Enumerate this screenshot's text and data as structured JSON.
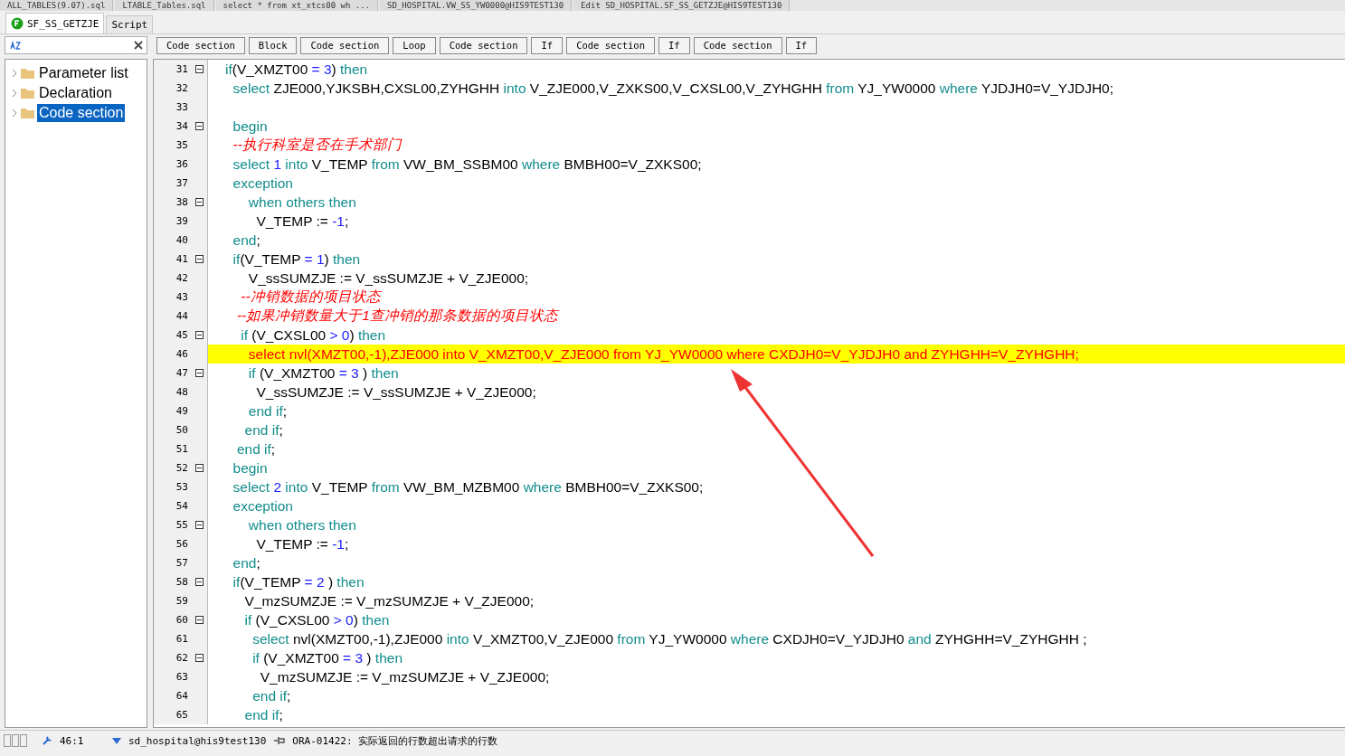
{
  "file_tabs": [
    "ALL_TABLES(9.07).sql",
    "LTABLE_Tables.sql",
    "select * from xt_xtcs00 wh ...",
    "SD_HOSPITAL.VW_SS_YW0000@HIS9TEST130",
    "Edit SD_HOSPITAL.SF_SS_GETZJE@HIS9TEST130"
  ],
  "doc_tabs": [
    {
      "label": "SF_SS_GETZJE",
      "selected": true
    },
    {
      "label": "Script",
      "selected": false
    }
  ],
  "breadcrumb": [
    "Code section",
    "Block",
    "Code section",
    "Loop",
    "Code section",
    "If",
    "Code section",
    "If",
    "Code section",
    "If"
  ],
  "tree": [
    {
      "label": "Parameter list",
      "selected": false
    },
    {
      "label": "Declaration",
      "selected": false
    },
    {
      "label": "Code section",
      "selected": true
    }
  ],
  "editor": {
    "lines": [
      {
        "no": "31",
        "fold": true,
        "selected": false,
        "segs": [
          {
            "kind": "keyword",
            "text": "if"
          },
          {
            "kind": "plain",
            "text": "(V_XMZT00 "
          },
          {
            "kind": "number",
            "text": "= 3"
          },
          {
            "kind": "plain",
            "text": ") "
          },
          {
            "kind": "keyword",
            "text": "then"
          }
        ]
      },
      {
        "no": "32",
        "fold": false,
        "selected": false,
        "segs": [
          {
            "kind": "keyword",
            "text": "  select "
          },
          {
            "kind": "plain",
            "text": "ZJE000,YJKSBH,CXSL00,ZYHGHH "
          },
          {
            "kind": "keyword",
            "text": "into "
          },
          {
            "kind": "plain",
            "text": "V_ZJE000,V_ZXKS00,V_CXSL00,V_ZYHGHH "
          },
          {
            "kind": "keyword",
            "text": "from "
          },
          {
            "kind": "plain",
            "text": "YJ_YW0000 "
          },
          {
            "kind": "keyword",
            "text": "where "
          },
          {
            "kind": "plain",
            "text": "YJDJH0=V_YJDJH0;"
          }
        ]
      },
      {
        "no": "33",
        "fold": false,
        "selected": false
      },
      {
        "no": "34",
        "fold": true,
        "selected": false,
        "segs": [
          {
            "kind": "keyword",
            "text": "  begin"
          }
        ]
      },
      {
        "no": "35",
        "fold": false,
        "selected": false,
        "segs": [
          {
            "kind": "comment",
            "text": "  --执行科室是否在手术部门"
          }
        ]
      },
      {
        "no": "36",
        "fold": false,
        "selected": false,
        "segs": [
          {
            "kind": "keyword",
            "text": "  select "
          },
          {
            "kind": "number",
            "text": "1 "
          },
          {
            "kind": "keyword",
            "text": "into "
          },
          {
            "kind": "plain",
            "text": "V_TEMP "
          },
          {
            "kind": "keyword",
            "text": "from "
          },
          {
            "kind": "plain",
            "text": "VW_BM_SSBM00 "
          },
          {
            "kind": "keyword",
            "text": "where "
          },
          {
            "kind": "plain",
            "text": "BMBH00=V_ZXKS00;"
          }
        ]
      },
      {
        "no": "37",
        "fold": false,
        "selected": false,
        "segs": [
          {
            "kind": "keyword",
            "text": "  exception"
          }
        ]
      },
      {
        "no": "38",
        "fold": true,
        "selected": false,
        "segs": [
          {
            "kind": "keyword",
            "text": "      when others then"
          }
        ]
      },
      {
        "no": "39",
        "fold": false,
        "selected": false,
        "segs": [
          {
            "kind": "plain",
            "text": "        V_TEMP := "
          },
          {
            "kind": "number",
            "text": "-1"
          },
          {
            "kind": "plain",
            "text": ";"
          }
        ]
      },
      {
        "no": "40",
        "fold": false,
        "selected": false,
        "segs": [
          {
            "kind": "keyword",
            "text": "  end"
          },
          {
            "kind": "plain",
            "text": ";"
          }
        ]
      },
      {
        "no": "41",
        "fold": true,
        "selected": false,
        "segs": [
          {
            "kind": "keyword",
            "text": "  if"
          },
          {
            "kind": "plain",
            "text": "(V_TEMP "
          },
          {
            "kind": "number",
            "text": "= 1"
          },
          {
            "kind": "plain",
            "text": ") "
          },
          {
            "kind": "keyword",
            "text": "then"
          }
        ]
      },
      {
        "no": "42",
        "fold": false,
        "selected": false,
        "segs": [
          {
            "kind": "plain",
            "text": "      V_ssSUMZJE := V_ssSUMZJE + V_ZJE000;"
          }
        ]
      },
      {
        "no": "43",
        "fold": false,
        "selected": false,
        "segs": [
          {
            "kind": "comment",
            "text": "    --冲销数据的项目状态"
          }
        ]
      },
      {
        "no": "44",
        "fold": false,
        "selected": false,
        "segs": [
          {
            "kind": "comment",
            "text": "   --如果冲销数量大于1查冲销的那条数据的项目状态"
          }
        ]
      },
      {
        "no": "45",
        "fold": true,
        "selected": false,
        "segs": [
          {
            "kind": "keyword",
            "text": "    if "
          },
          {
            "kind": "plain",
            "text": "(V_CXSL00 "
          },
          {
            "kind": "number",
            "text": "> 0"
          },
          {
            "kind": "plain",
            "text": ") "
          },
          {
            "kind": "keyword",
            "text": "then"
          }
        ]
      },
      {
        "no": "46",
        "fold": false,
        "selected": true,
        "segs": [
          {
            "kind": "plain",
            "text": "      select nvl(XMZT00,-1),ZJE000 into V_XMZT00,V_ZJE000 from YJ_YW0000 where CXDJH0=V_YJDJH0 and ZYHGHH=V_ZYHGHH;"
          }
        ]
      },
      {
        "no": "47",
        "fold": true,
        "selected": false,
        "segs": [
          {
            "kind": "keyword",
            "text": "      if "
          },
          {
            "kind": "plain",
            "text": "(V_XMZT00 "
          },
          {
            "kind": "number",
            "text": "= 3 "
          },
          {
            "kind": "plain",
            "text": ") "
          },
          {
            "kind": "keyword",
            "text": "then"
          }
        ]
      },
      {
        "no": "48",
        "fold": false,
        "selected": false,
        "segs": [
          {
            "kind": "plain",
            "text": "        V_ssSUMZJE := V_ssSUMZJE + V_ZJE000;"
          }
        ]
      },
      {
        "no": "49",
        "fold": false,
        "selected": false,
        "segs": [
          {
            "kind": "keyword",
            "text": "      end if"
          },
          {
            "kind": "plain",
            "text": ";"
          }
        ]
      },
      {
        "no": "50",
        "fold": false,
        "selected": false,
        "segs": [
          {
            "kind": "keyword",
            "text": "     end if"
          },
          {
            "kind": "plain",
            "text": ";"
          }
        ]
      },
      {
        "no": "51",
        "fold": false,
        "selected": false,
        "segs": [
          {
            "kind": "keyword",
            "text": "   end if"
          },
          {
            "kind": "plain",
            "text": ";"
          }
        ]
      },
      {
        "no": "52",
        "fold": true,
        "selected": false,
        "segs": [
          {
            "kind": "keyword",
            "text": "  begin"
          }
        ]
      },
      {
        "no": "53",
        "fold": false,
        "selected": false,
        "segs": [
          {
            "kind": "keyword",
            "text": "  select "
          },
          {
            "kind": "number",
            "text": "2 "
          },
          {
            "kind": "keyword",
            "text": "into "
          },
          {
            "kind": "plain",
            "text": "V_TEMP "
          },
          {
            "kind": "keyword",
            "text": "from "
          },
          {
            "kind": "plain",
            "text": "VW_BM_MZBM00 "
          },
          {
            "kind": "keyword",
            "text": "where "
          },
          {
            "kind": "plain",
            "text": "BMBH00=V_ZXKS00;"
          }
        ]
      },
      {
        "no": "54",
        "fold": false,
        "selected": false,
        "segs": [
          {
            "kind": "keyword",
            "text": "  exception"
          }
        ]
      },
      {
        "no": "55",
        "fold": true,
        "selected": false,
        "segs": [
          {
            "kind": "keyword",
            "text": "      when others then"
          }
        ]
      },
      {
        "no": "56",
        "fold": false,
        "selected": false,
        "segs": [
          {
            "kind": "plain",
            "text": "        V_TEMP := "
          },
          {
            "kind": "number",
            "text": "-1"
          },
          {
            "kind": "plain",
            "text": ";"
          }
        ]
      },
      {
        "no": "57",
        "fold": false,
        "selected": false,
        "segs": [
          {
            "kind": "keyword",
            "text": "  end"
          },
          {
            "kind": "plain",
            "text": ";"
          }
        ]
      },
      {
        "no": "58",
        "fold": true,
        "selected": false,
        "segs": [
          {
            "kind": "keyword",
            "text": "  if"
          },
          {
            "kind": "plain",
            "text": "(V_TEMP "
          },
          {
            "kind": "number",
            "text": "= 2 "
          },
          {
            "kind": "plain",
            "text": ") "
          },
          {
            "kind": "keyword",
            "text": "then"
          }
        ]
      },
      {
        "no": "59",
        "fold": false,
        "selected": false,
        "segs": [
          {
            "kind": "plain",
            "text": "     V_mzSUMZJE := V_mzSUMZJE + V_ZJE000;"
          }
        ]
      },
      {
        "no": "60",
        "fold": true,
        "selected": false,
        "segs": [
          {
            "kind": "keyword",
            "text": "     if "
          },
          {
            "kind": "plain",
            "text": "(V_CXSL00 "
          },
          {
            "kind": "number",
            "text": "> 0"
          },
          {
            "kind": "plain",
            "text": ") "
          },
          {
            "kind": "keyword",
            "text": "then"
          }
        ]
      },
      {
        "no": "61",
        "fold": false,
        "selected": false,
        "segs": [
          {
            "kind": "keyword",
            "text": "       select "
          },
          {
            "kind": "plain",
            "text": "nvl(XMZT00,-1),ZJE000 "
          },
          {
            "kind": "keyword",
            "text": "into "
          },
          {
            "kind": "plain",
            "text": "V_XMZT00,V_ZJE000 "
          },
          {
            "kind": "keyword",
            "text": "from "
          },
          {
            "kind": "plain",
            "text": "YJ_YW0000 "
          },
          {
            "kind": "keyword",
            "text": "where "
          },
          {
            "kind": "plain",
            "text": "CXDJH0=V_YJDJH0 "
          },
          {
            "kind": "keyword",
            "text": "and "
          },
          {
            "kind": "plain",
            "text": "ZYHGHH=V_ZYHGHH ;"
          }
        ]
      },
      {
        "no": "62",
        "fold": true,
        "selected": false,
        "segs": [
          {
            "kind": "keyword",
            "text": "       if "
          },
          {
            "kind": "plain",
            "text": "(V_XMZT00 "
          },
          {
            "kind": "number",
            "text": "= 3 "
          },
          {
            "kind": "plain",
            "text": ") "
          },
          {
            "kind": "keyword",
            "text": "then"
          }
        ]
      },
      {
        "no": "63",
        "fold": false,
        "selected": false,
        "segs": [
          {
            "kind": "plain",
            "text": "         V_mzSUMZJE := V_mzSUMZJE + V_ZJE000;"
          }
        ]
      },
      {
        "no": "64",
        "fold": false,
        "selected": false,
        "segs": [
          {
            "kind": "keyword",
            "text": "       end if"
          },
          {
            "kind": "plain",
            "text": ";"
          }
        ]
      },
      {
        "no": "65",
        "fold": false,
        "selected": false,
        "segs": [
          {
            "kind": "keyword",
            "text": "     end if"
          },
          {
            "kind": "plain",
            "text": ";"
          }
        ]
      }
    ]
  },
  "status": {
    "position": "46:1",
    "connection": "sd_hospital@his9test130",
    "message": "ORA-01422: 实际返回的行数超出请求的行数"
  }
}
